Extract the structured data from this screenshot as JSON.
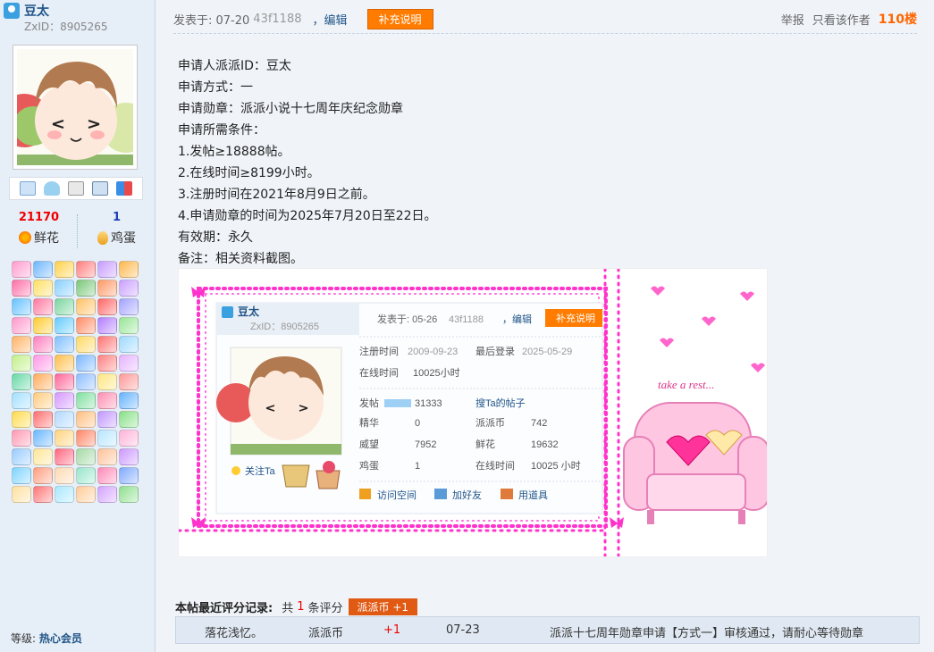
{
  "user": {
    "name": "豆太",
    "zxid": "ZxID：8905265",
    "flowers_value": "21170",
    "flowers_label": "鲜花",
    "eggs_value": "1",
    "eggs_label": "鸡蛋",
    "level_label": "等级:",
    "level_value": "热心会员"
  },
  "post": {
    "posted_time": "发表于: 07-20",
    "hash": "43f1188",
    "edit_link": "，编辑",
    "supplement_button": "补充说明",
    "report": "举报",
    "author_only": "只看该作者",
    "floor": "110楼"
  },
  "content_lines": [
    "申请人派派ID：豆太",
    "申请方式：一",
    "申请勋章：派派小说十七周年庆纪念勋章",
    "申请所需条件：",
    "1.发帖≥18888帖。",
    "2.在线时间≥8199小时。",
    "3.注册时间在2021年8月9日之前。",
    "4.申请勋章的时间为2025年7月20日至22日。",
    "有效期：永久",
    "备注：相关资料截图。"
  ],
  "screenshot": {
    "username": "豆太",
    "zxid": "ZxID：8905265",
    "posted": "发表于: 05-26",
    "hash": "43f1188",
    "edit": "，编辑",
    "supp": "补充说明",
    "reg_label": "注册时间",
    "reg_value": "2009-09-23",
    "last_label": "最后登录",
    "last_value": "2025-05-29",
    "online_label": "在线时间",
    "online_value": "10025小时",
    "posts_label": "发帖",
    "posts_value": "31333",
    "search_posts": "搜Ta的帖子",
    "elite_label": "精华",
    "elite_value": "0",
    "coin_label": "派派币",
    "coin_value": "742",
    "prestige_label": "威望",
    "prestige_value": "7952",
    "flowers_label": "鲜花",
    "flowers_value": "19632",
    "eggs_label": "鸡蛋",
    "eggs_value": "1",
    "online2_label": "在线时间",
    "online2_value": "10025 小时",
    "follow": "关注Ta",
    "visit": "访问空间",
    "add_friend": "加好友",
    "use_tool": "用道具",
    "take_rest": "take a rest..."
  },
  "rating": {
    "title": "本帖最近评分记录:",
    "count_prefix": "共",
    "count": "1",
    "count_suffix": "条评分",
    "badge": "派派币 +1",
    "row": {
      "user": "落花浅忆。",
      "currency": "派派币",
      "amount": "+1",
      "date": "07-23",
      "reason": "派派十七周年勋章申请【方式一】审核通过，请耐心等待勋章"
    }
  },
  "colors": {
    "accent_orange": "#ff7c00",
    "link_blue": "#225588",
    "floor_orange": "#ff6600",
    "frame_pink": "#ff33cc"
  },
  "medals": [
    "#ff9ccf",
    "#6fb7ff",
    "#ffd24d",
    "#ff7f7f",
    "#c79cff",
    "#ffb84d",
    "#ff6fa8",
    "#ffe066",
    "#88d0ff",
    "#7ac77a",
    "#ff9966",
    "#c9a0ff",
    "#66c2ff",
    "#ff7aa2",
    "#7bd6a0",
    "#ffc266",
    "#ff6666",
    "#a3a3ff",
    "#ff99cc",
    "#ffcc33",
    "#66ccff",
    "#ff8c66",
    "#b37fff",
    "#99e699",
    "#ffb366",
    "#ff80bf",
    "#80c0ff",
    "#ffd966",
    "#ff7373",
    "#9fd9ff",
    "#c2f08a",
    "#ff99e6",
    "#ffc04d",
    "#7ab8ff",
    "#ff8080",
    "#e6b3ff",
    "#66d9a6",
    "#ffad5c",
    "#ff6699",
    "#8fbfff",
    "#ffe680",
    "#ff9999",
    "#a3e0ff",
    "#ffcc80",
    "#d699ff",
    "#80e0a0",
    "#ff8fb3",
    "#66b3ff",
    "#ffdb4d",
    "#ff7070",
    "#b3d9ff",
    "#ffbf80",
    "#c299ff",
    "#88e088",
    "#ff99b3",
    "#6cb8ff",
    "#ffd480",
    "#ff8566",
    "#b8e6ff",
    "#ffb3d9",
    "#99ccff",
    "#ffe699",
    "#ff6680",
    "#a6d9a6",
    "#ffc299",
    "#cc99ff",
    "#7fd4ff",
    "#ff9f80",
    "#ffd9b3",
    "#99e6cc",
    "#ff8ab8",
    "#80aaff",
    "#ffe0a0",
    "#ff7777",
    "#aae8ff",
    "#ffcc99",
    "#d4a3ff",
    "#8fe08f"
  ]
}
